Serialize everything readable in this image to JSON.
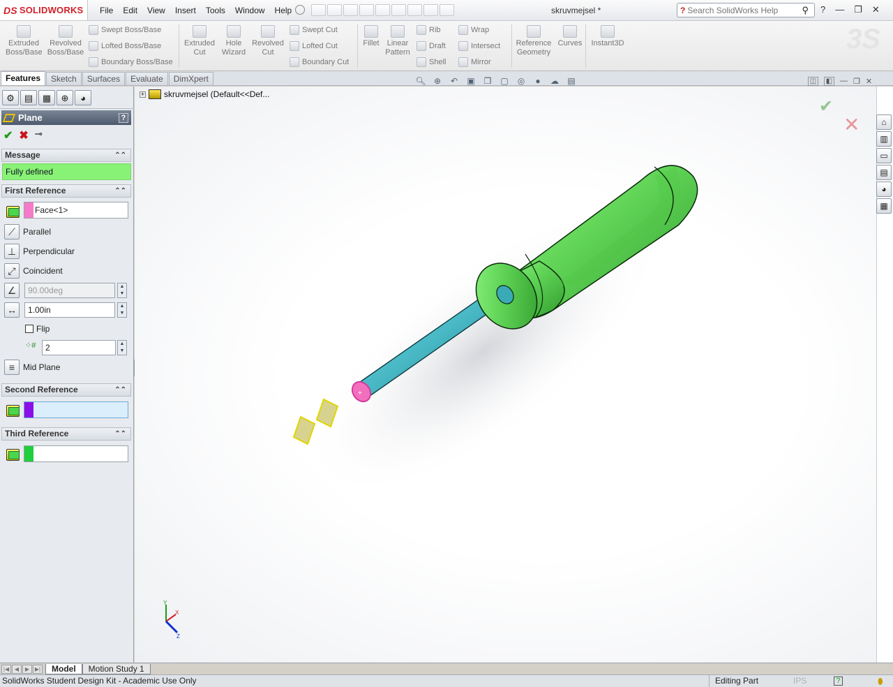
{
  "app": {
    "logo_prefix": "DS",
    "logo_text": "SOLIDWORKS",
    "document_title": "skruvmejsel *"
  },
  "menu": [
    "File",
    "Edit",
    "View",
    "Insert",
    "Tools",
    "Window",
    "Help"
  ],
  "search": {
    "placeholder": "Search SolidWorks Help"
  },
  "features_toolbar": {
    "extruded_boss": "Extruded Boss/Base",
    "revolved_boss": "Revolved Boss/Base",
    "swept_boss": "Swept Boss/Base",
    "lofted_boss": "Lofted Boss/Base",
    "boundary_boss": "Boundary Boss/Base",
    "extruded_cut": "Extruded Cut",
    "hole_wizard": "Hole Wizard",
    "revolved_cut": "Revolved Cut",
    "swept_cut": "Swept Cut",
    "lofted_cut": "Lofted Cut",
    "boundary_cut": "Boundary Cut",
    "fillet": "Fillet",
    "linear_pattern": "Linear Pattern",
    "rib": "Rib",
    "draft": "Draft",
    "shell": "Shell",
    "wrap": "Wrap",
    "intersect": "Intersect",
    "mirror": "Mirror",
    "reference_geometry": "Reference Geometry",
    "curves": "Curves",
    "instant3d": "Instant3D"
  },
  "tabs": [
    "Features",
    "Sketch",
    "Surfaces",
    "Evaluate",
    "DimXpert"
  ],
  "property_manager": {
    "title": "Plane",
    "help": "?",
    "message_header": "Message",
    "message": "Fully defined",
    "first_reference": {
      "header": "First Reference",
      "selection": "Face<1>",
      "swatch_color": "#f57ac8",
      "options": {
        "parallel": "Parallel",
        "perpendicular": "Perpendicular",
        "coincident": "Coincident"
      },
      "angle": "90.00deg",
      "distance": "1.00in",
      "flip": "Flip",
      "flip_checked": false,
      "instances": "2",
      "mid_plane": "Mid Plane"
    },
    "second_reference": {
      "header": "Second Reference",
      "selection": "",
      "swatch_color": "#8a10e8"
    },
    "third_reference": {
      "header": "Third Reference",
      "selection": "",
      "swatch_color": "#1fcf3c"
    }
  },
  "feature_tree": {
    "root": "skruvmejsel  (Default<<Def..."
  },
  "triad": {
    "x": "X",
    "y": "Y",
    "z": "Z"
  },
  "colors": {
    "handle": "#5fd356",
    "shaft": "#48b8c4",
    "selected_face": "#f26fbe",
    "preview_plane": "#e0d500"
  },
  "bottom_tabs": [
    "Model",
    "Motion Study 1"
  ],
  "status": {
    "left": "SolidWorks Student Design Kit - Academic Use Only",
    "mode": "Editing Part",
    "units": "IPS"
  }
}
